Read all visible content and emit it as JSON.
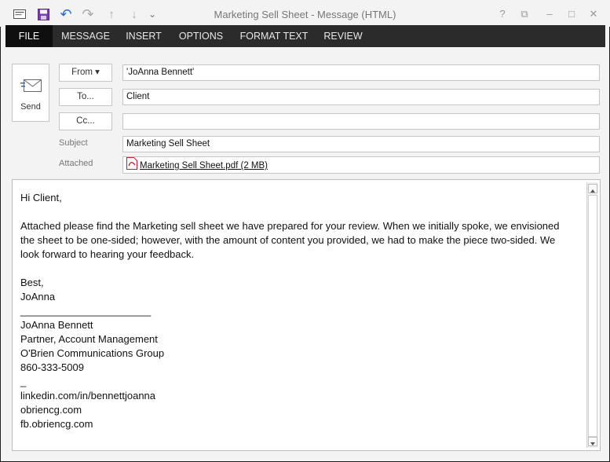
{
  "window": {
    "title": "Marketing Sell Sheet - Message (HTML)"
  },
  "quick_access": {
    "icons": [
      "envelope-icon",
      "save-icon",
      "undo-icon",
      "redo-icon",
      "up-arrow-icon",
      "down-arrow-icon",
      "customize-qat-icon"
    ],
    "undo_glyph": "↶",
    "redo_glyph": "↷",
    "up_glyph": "↑",
    "down_glyph": "↓",
    "more_glyph": "⌄"
  },
  "window_controls": {
    "help": "?",
    "restore_ribbon": "⧉",
    "minimize": "–",
    "maximize": "□",
    "close": "✕"
  },
  "ribbon": {
    "tabs": [
      "FILE",
      "MESSAGE",
      "INSERT",
      "OPTIONS",
      "FORMAT TEXT",
      "REVIEW"
    ]
  },
  "compose": {
    "send_label": "Send",
    "from_button": "From ▾",
    "from_value": "'JoAnna Bennett'",
    "to_button": "To...",
    "to_value": "Client",
    "cc_button": "Cc...",
    "cc_value": "",
    "subject_label": "Subject",
    "subject_value": "Marketing Sell Sheet",
    "attached_label": "Attached",
    "attachment": "Marketing Sell Sheet.pdf (2 MB)"
  },
  "message": {
    "greeting": "Hi Client,",
    "paragraph": "Attached please find the Marketing sell sheet we have prepared for your review. When we initially spoke, we envisioned the sheet to be one-sided; however, with the amount of content you provided, we had to make the piece two-sided. We look forward to hearing your feedback.",
    "closing": "Best,",
    "sender_short": "JoAnna",
    "divider": "_______________________",
    "sig_name": "JoAnna Bennett",
    "sig_title": "Partner, Account Management",
    "sig_company": "O'Brien Communications Group",
    "sig_phone": "860-333-5009",
    "sig_dash": "_",
    "sig_linkedin": "linkedin.com/in/bennettjoanna",
    "sig_web": "obriencg.com",
    "sig_fb": "fb.obriencg.com"
  },
  "colors": {
    "ribbon_bg": "#2b2b2b",
    "file_tab_bg": "#0f0f0f",
    "accent_blue": "#2e6bc7",
    "save_purple": "#7a3cae",
    "pdf_red": "#c8202f"
  }
}
